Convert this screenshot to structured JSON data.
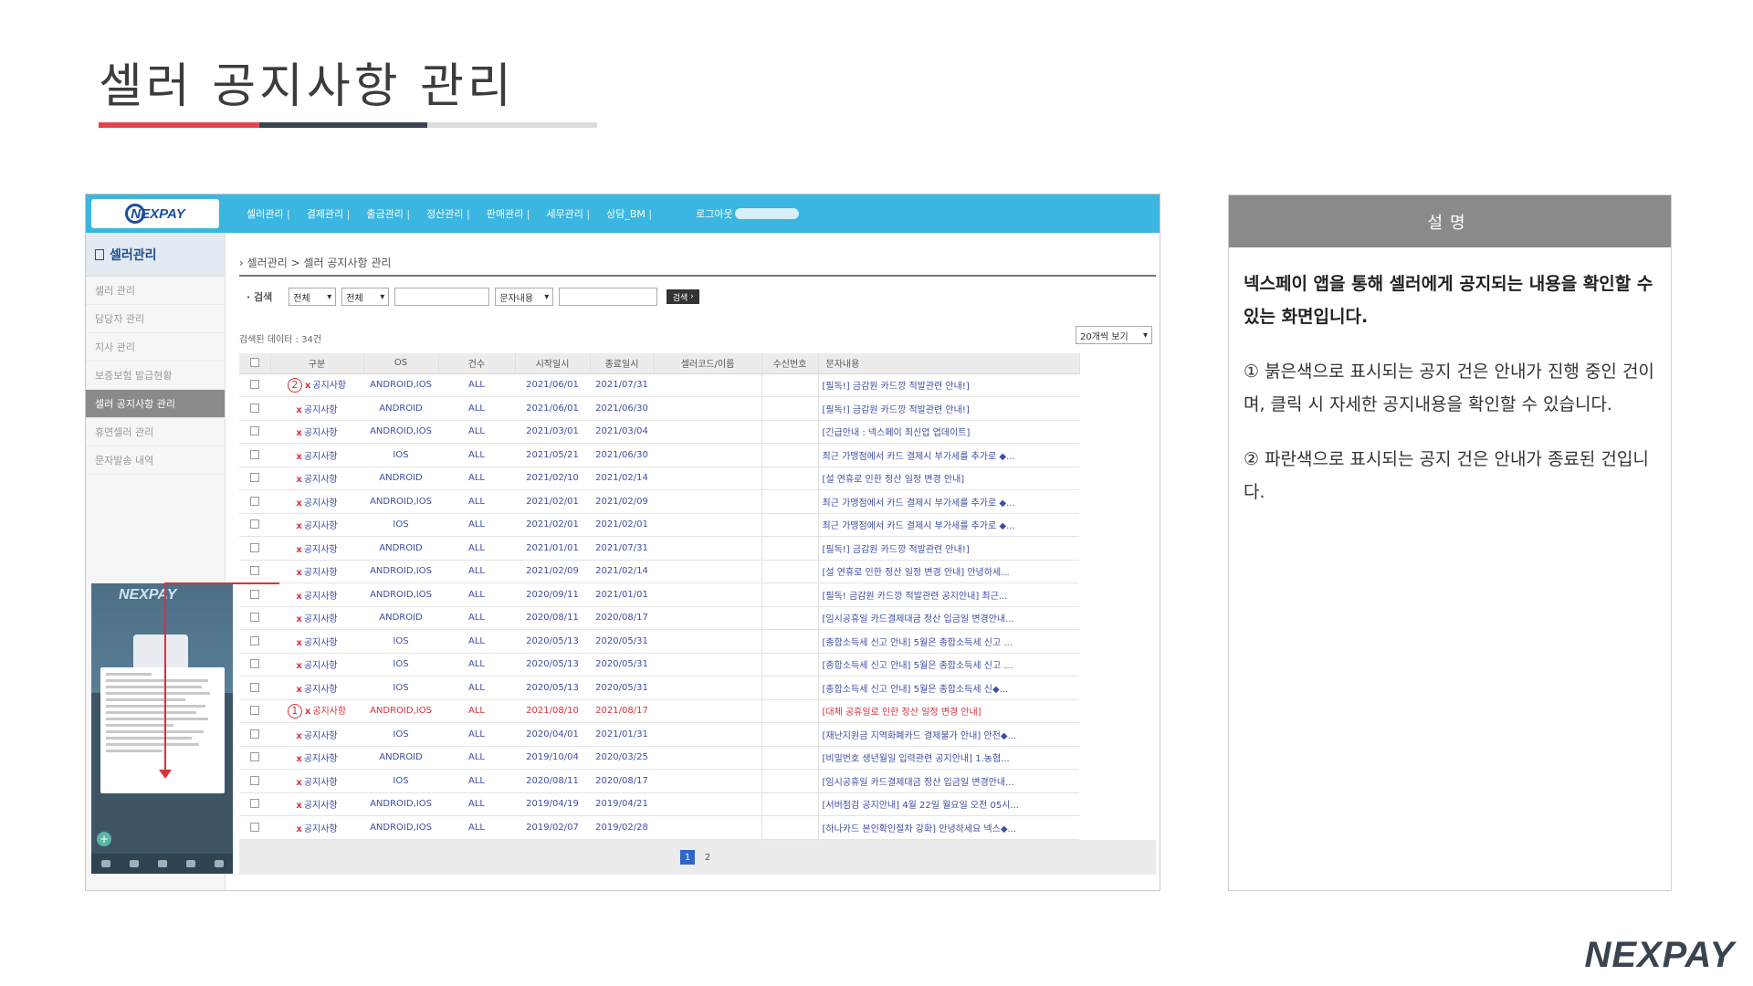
{
  "slide": {
    "title": "셀러 공지사항 관리",
    "footer_logo": "NEXPAY"
  },
  "app": {
    "logo": "NEXPAY",
    "menu": [
      "셀러관리",
      "결제관리",
      "출금관리",
      "정산관리",
      "판매관리",
      "세무관리",
      "상담_BM"
    ],
    "logout": "로그아웃"
  },
  "sidebar": {
    "title": "셀러관리",
    "items": [
      {
        "label": "셀러 관리"
      },
      {
        "label": "담당자 관리"
      },
      {
        "label": "지사 관리"
      },
      {
        "label": "보증보험 발급현황"
      },
      {
        "label": "셀러 공지사항 관리"
      },
      {
        "label": "휴면셀러 관리"
      },
      {
        "label": "문자발송 내역"
      }
    ]
  },
  "phone_preview": {
    "logo": "NEXPAY"
  },
  "main": {
    "breadcrumb": "셀러관리 > 셀러 공지사항 관리",
    "search": {
      "label": "검색",
      "select1": "전체",
      "select2": "전체",
      "select3": "문자내용",
      "button": "검색"
    },
    "result_count": "검색된 데이터 : 34건",
    "page_size": "20개씩 보기",
    "columns": [
      "구분",
      "OS",
      "건수",
      "시작일시",
      "종료일시",
      "셀러코드/이름",
      "수신번호",
      "문자내용"
    ],
    "rows": [
      {
        "cat": "공지사항",
        "os": "ANDROID,IOS",
        "cnt": "ALL",
        "start": "2021/06/01",
        "end": "2021/07/31",
        "msg": "[필독!] 금감원 카드깡 적발관련 안내!]",
        "badge": "2"
      },
      {
        "cat": "공지사항",
        "os": "ANDROID",
        "cnt": "ALL",
        "start": "2021/06/01",
        "end": "2021/06/30",
        "msg": "[필독!] 금감원 카드깡 적발관련 안내!]"
      },
      {
        "cat": "공지사항",
        "os": "ANDROID,IOS",
        "cnt": "ALL",
        "start": "2021/03/01",
        "end": "2021/03/04",
        "msg": "[긴급안내 : 넥스페이 최신업 업데이트]"
      },
      {
        "cat": "공지사항",
        "os": "IOS",
        "cnt": "ALL",
        "start": "2021/05/21",
        "end": "2021/06/30",
        "msg": "최근 가맹점에서 카드 결제시 부가세를 추가로 ◆..."
      },
      {
        "cat": "공지사항",
        "os": "ANDROID",
        "cnt": "ALL",
        "start": "2021/02/10",
        "end": "2021/02/14",
        "msg": "[설 연휴로 인한 정산 일정 변경 안내]"
      },
      {
        "cat": "공지사항",
        "os": "ANDROID,IOS",
        "cnt": "ALL",
        "start": "2021/02/01",
        "end": "2021/02/09",
        "msg": "최근 가맹점에서 카드 결제시 부가세를 추가로 ◆..."
      },
      {
        "cat": "공지사항",
        "os": "IOS",
        "cnt": "ALL",
        "start": "2021/02/01",
        "end": "2021/02/01",
        "msg": "최근 가맹점에서 카드 결제시 부가세를 추가로 ◆..."
      },
      {
        "cat": "공지사항",
        "os": "ANDROID",
        "cnt": "ALL",
        "start": "2021/01/01",
        "end": "2021/07/31",
        "msg": "[필독!] 금감원 카드깡 적발관련 안내!]"
      },
      {
        "cat": "공지사항",
        "os": "ANDROID,IOS",
        "cnt": "ALL",
        "start": "2021/02/09",
        "end": "2021/02/14",
        "msg": "[설 연휴로 인한 정산 일정 변경 안내] 안녕하세..."
      },
      {
        "cat": "공지사항",
        "os": "ANDROID,IOS",
        "cnt": "ALL",
        "start": "2020/09/11",
        "end": "2021/01/01",
        "msg": "[필독! 금감원 카드깡 적발관련 공지안내] 최근..."
      },
      {
        "cat": "공지사항",
        "os": "ANDROID",
        "cnt": "ALL",
        "start": "2020/08/11",
        "end": "2020/08/17",
        "msg": "[임시공휴일 카드결제대금 정산 입금일 변경안내..."
      },
      {
        "cat": "공지사항",
        "os": "IOS",
        "cnt": "ALL",
        "start": "2020/05/13",
        "end": "2020/05/31",
        "msg": "[종합소득세 신고 안내] 5월은 종합소득세 신고 ..."
      },
      {
        "cat": "공지사항",
        "os": "IOS",
        "cnt": "ALL",
        "start": "2020/05/13",
        "end": "2020/05/31",
        "msg": "[종합소득세 신고 안내] 5월은 종합소득세 신고 ..."
      },
      {
        "cat": "공지사항",
        "os": "IOS",
        "cnt": "ALL",
        "start": "2020/05/13",
        "end": "2020/05/31",
        "msg": "[종합소득세 신고 안내] 5월은 종합소득세 신◆..."
      },
      {
        "cat": "공지사항",
        "os": "ANDROID,IOS",
        "cnt": "ALL",
        "start": "2021/08/10",
        "end": "2021/08/17",
        "msg": "[대체 공휴일로 인한 정산 일정 변경 안내]",
        "badge": "1",
        "red": true
      },
      {
        "cat": "공지사항",
        "os": "IOS",
        "cnt": "ALL",
        "start": "2020/04/01",
        "end": "2021/01/31",
        "msg": "[재난지원금 지역화폐카드 결제불가 안내] 안전◆..."
      },
      {
        "cat": "공지사항",
        "os": "ANDROID",
        "cnt": "ALL",
        "start": "2019/10/04",
        "end": "2020/03/25",
        "msg": "[비밀번호 생년월일 입력관련 공지안내] 1.농협..."
      },
      {
        "cat": "공지사항",
        "os": "IOS",
        "cnt": "ALL",
        "start": "2020/08/11",
        "end": "2020/08/17",
        "msg": "[임시공휴일 카드결제대금 정산 입금일 변경안내..."
      },
      {
        "cat": "공지사항",
        "os": "ANDROID,IOS",
        "cnt": "ALL",
        "start": "2019/04/19",
        "end": "2019/04/21",
        "msg": "[서버점검 공지안내] 4월 22일 월요일 오전 05시..."
      },
      {
        "cat": "공지사항",
        "os": "ANDROID,IOS",
        "cnt": "ALL",
        "start": "2019/02/07",
        "end": "2019/02/28",
        "msg": "[하나카드 본인확인절차 강화] 안녕하세요 넥스◆..."
      }
    ],
    "pages": [
      "1",
      "2"
    ]
  },
  "description": {
    "header": "설명",
    "lead": "넥스페이 앱을 통해 셀러에게 공지되는 내용을 확인할 수 있는 화면입니다.",
    "p1": "① 붉은색으로 표시되는 공지 건은 안내가 진행 중인 건이며, 클릭 시 자세한 공지내용을 확인할 수 있습니다.",
    "p2": "② 파란색으로 표시되는 공지 건은 안내가 종료된 건입니다."
  },
  "colors": {
    "nav": "#3bb6e0",
    "accent_red": "#d9323a",
    "accent_blue": "#3d4ea6",
    "brand_dark": "#3a4450"
  }
}
